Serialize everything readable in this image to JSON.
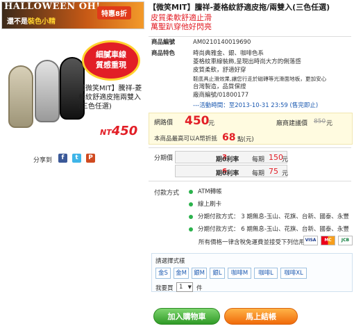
{
  "banner": {
    "title": "HALLOWEEN OH!",
    "subtitle_1": "還不是",
    "subtitle_highlight": "裝色小精",
    "tag": "特惠8折"
  },
  "promo_circle": [
    "細膩車線",
    "質感重現"
  ],
  "left_product_name": "【微笑MIT】騰祥-菱格紋舒適皮拖兩雙入(三色任選)",
  "left_price_prefix": "NT",
  "left_price": "450",
  "share": {
    "label": "分享到",
    "icons": [
      "facebook-icon",
      "twitter-icon",
      "plurk-icon"
    ],
    "icon_glyphs": [
      "f",
      "t",
      "P"
    ]
  },
  "product": {
    "title": "【微笑MIT】騰祥-菱格紋舒適皮拖/兩雙入(三色任選)",
    "subtitle_lines": [
      "皮質柔軟舒適止滑",
      "萬聖趴穿他好閃亮"
    ],
    "code_label": "商品編號",
    "code": "AM0210140019690",
    "features_label": "商品特色",
    "features": [
      "時尚典雅金、銀、咖啡色系",
      "菱格紋車線裝飾,呈現出時尚大方的俐落感",
      "皮質柔軟，舒適好穿",
      "鞋底具止滑效果,讓您行走於磁磚等光滑面地板，更加安心",
      "台灣製造，品質保證",
      "廠商編號/01800177"
    ],
    "activity": "---活動時間：至2013-10-31 23:59 (售完即止)"
  },
  "pricing": {
    "net_label": "網路價",
    "net_price": "450",
    "unit": "元",
    "suggest_label": "廠商建議價",
    "suggest_price": "850",
    "offset_label": "本商品最高可以A幣折抵",
    "offset_value": "68",
    "offset_unit": "點(元)"
  },
  "installment": {
    "label": "分期價",
    "rows": [
      {
        "n": "3",
        "rate": "期0利率",
        "each": "每期",
        "amount": "150",
        "unit": "元"
      },
      {
        "n": "6",
        "rate": "期0利率",
        "each": "每期",
        "amount": "75",
        "unit": "元"
      }
    ]
  },
  "payment": {
    "label": "付款方式",
    "items": [
      "ATM轉帳",
      "線上刷卡",
      "分期付款方式： 3 期無息-玉山、花旗、台新、國泰、永豐",
      "分期付款方式： 6 期無息-玉山、花旗、台新、國泰、永豐"
    ],
    "note": "所有價格一律含稅免運費並接受下列信用卡",
    "cards": [
      "VISA",
      "MC",
      "JCB"
    ]
  },
  "spec": {
    "label": "請選擇式樣",
    "options": [
      "金S",
      "金M",
      "銀M",
      "銀L",
      "咖啡M",
      "咖啡L",
      "咖啡XL"
    ],
    "qty_label": "我要買",
    "qty_value": "1",
    "qty_unit": "件"
  },
  "buttons": {
    "add_cart": "加入購物車",
    "buy_now": "馬上結帳"
  },
  "colors": {
    "accent_red": "#e21e26",
    "link_blue": "#1a58b0",
    "cart_green": "#2f9a26",
    "buy_orange": "#f06a0a"
  }
}
